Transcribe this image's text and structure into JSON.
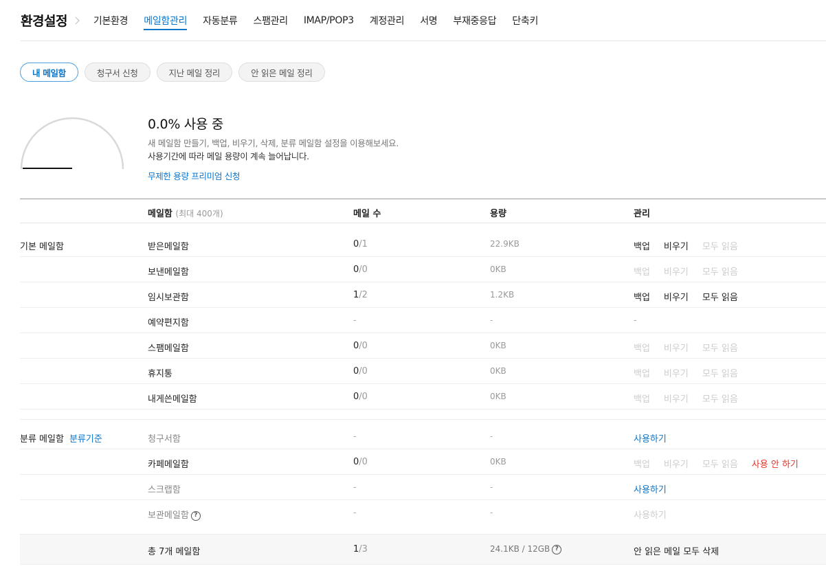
{
  "nav": {
    "title": "환경설정",
    "items": [
      {
        "label": "기본환경",
        "active": false
      },
      {
        "label": "메일함관리",
        "active": true
      },
      {
        "label": "자동분류",
        "active": false
      },
      {
        "label": "스팸관리",
        "active": false
      },
      {
        "label": "IMAP/POP3",
        "active": false
      },
      {
        "label": "계정관리",
        "active": false
      },
      {
        "label": "서명",
        "active": false
      },
      {
        "label": "부재중응답",
        "active": false
      },
      {
        "label": "단축키",
        "active": false
      }
    ]
  },
  "pills": [
    "내 메일함",
    "청구서 신청",
    "지난 메일 정리",
    "안 읽은 메일 정리"
  ],
  "usage": {
    "percent": 0.0,
    "title": "0.0% 사용 중",
    "desc1": "새 메일함 만들기, 백업, 비우기, 삭제, 분류 메일함 설정을 이용해보세요.",
    "desc2": "사용기간에 따라 메일 용량이 계속 늘어납니다.",
    "premium_link": "무제한 용량 프리미엄 신청"
  },
  "table": {
    "col_name": "메일함",
    "col_name_sub": "(최대 400개)",
    "col_count": "메일 수",
    "col_size": "용량",
    "col_manage": "관리",
    "group_basic": "기본 메일함",
    "group_category": "분류 메일함",
    "group_category_link": "분류기준",
    "basic_rows": [
      {
        "name": "받은메일함",
        "unread": "0",
        "total": "/1",
        "size": "22.9KB",
        "backup": "백업",
        "empty": "비우기",
        "readall": "모두 읽음",
        "enabled": [
          true,
          true,
          false
        ]
      },
      {
        "name": "보낸메일함",
        "unread": "0",
        "total": "/0",
        "size": "0KB",
        "backup": "백업",
        "empty": "비우기",
        "readall": "모두 읽음",
        "enabled": [
          false,
          false,
          false
        ]
      },
      {
        "name": "임시보관함",
        "unread": "1",
        "total": "/2",
        "size": "1.2KB",
        "backup": "백업",
        "empty": "비우기",
        "readall": "모두 읽음",
        "enabled": [
          true,
          true,
          true
        ]
      },
      {
        "name": "예약편지함",
        "dash": "-"
      },
      {
        "name": "스팸메일함",
        "unread": "0",
        "total": "/0",
        "size": "0KB",
        "backup": "백업",
        "empty": "비우기",
        "readall": "모두 읽음",
        "enabled": [
          false,
          false,
          false
        ]
      },
      {
        "name": "휴지통",
        "unread": "0",
        "total": "/0",
        "size": "0KB",
        "backup": "백업",
        "empty": "비우기",
        "readall": "모두 읽음",
        "enabled": [
          false,
          false,
          false
        ]
      },
      {
        "name": "내게쓴메일함",
        "unread": "0",
        "total": "/0",
        "size": "0KB",
        "backup": "백업",
        "empty": "비우기",
        "readall": "모두 읽음",
        "enabled": [
          false,
          false,
          false
        ]
      }
    ],
    "category_rows": {
      "bill": {
        "name": "청구서함",
        "dash": "-",
        "use": "사용하기"
      },
      "cafe": {
        "name": "카페메일함",
        "unread": "0",
        "total": "/0",
        "size": "0KB",
        "backup": "백업",
        "empty": "비우기",
        "readall": "모두 읽음",
        "disable": "사용 안 하기"
      },
      "scrap": {
        "name": "스크랩함",
        "dash": "-",
        "use": "사용하기"
      },
      "archive": {
        "name": "보관메일함",
        "dash": "-",
        "use": "사용하기"
      }
    },
    "footer": {
      "total_label": "총 7개 메일함",
      "unread": "1",
      "total": "/3",
      "size": "24.1KB / 12GB",
      "delete_unread": "안 읽은 메일 모두 삭제"
    }
  },
  "colors": {
    "accent": "#0b75c9",
    "danger": "#e0362c",
    "disabled": "#cccccc"
  }
}
